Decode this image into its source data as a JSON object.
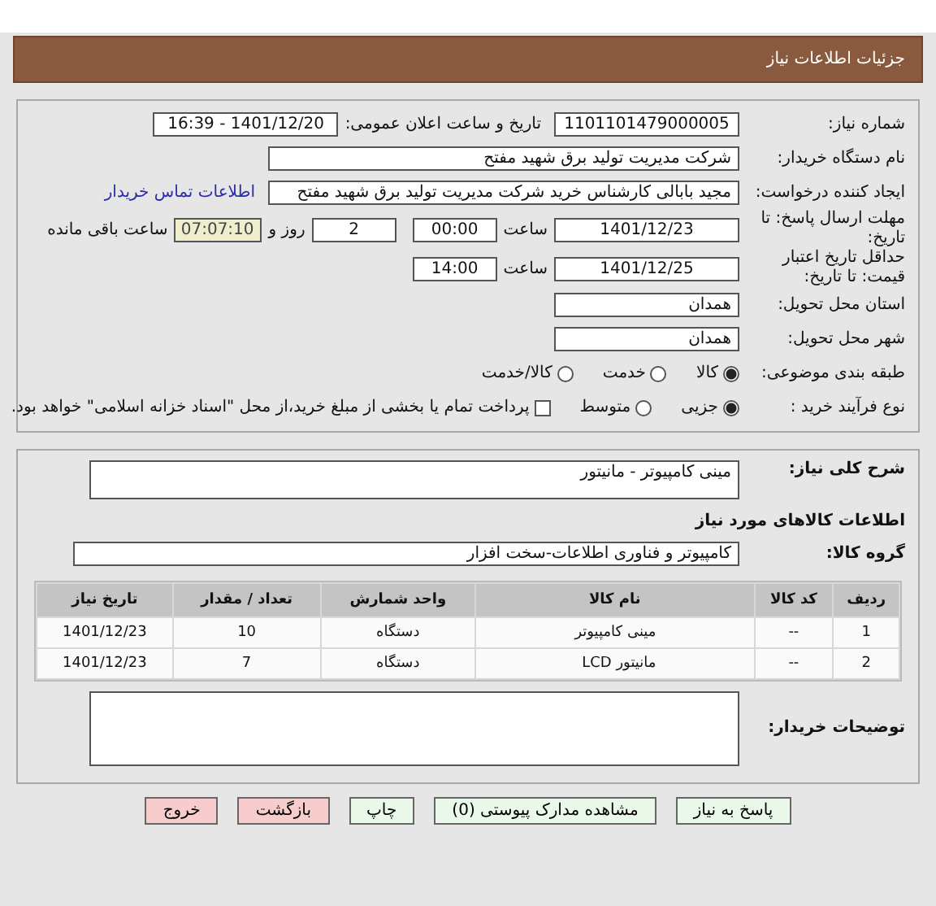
{
  "header": {
    "title": "جزئیات اطلاعات نیاز"
  },
  "need_number": {
    "label": "شماره نیاز:",
    "value": "1101101479000005"
  },
  "announce": {
    "label": "تاریخ و ساعت اعلان عمومی:",
    "value": "1401/12/20 - 16:39"
  },
  "buyer": {
    "label": "نام دستگاه خریدار:",
    "value": "شرکت مدیریت تولید برق شهید مفتح"
  },
  "creator": {
    "label": "ایجاد کننده درخواست:",
    "value": "مجید بابالی کارشناس خرید شرکت مدیریت تولید برق شهید مفتح",
    "link": "اطلاعات تماس خریدار"
  },
  "deadline": {
    "label": "مهلت ارسال پاسخ: تا تاریخ:",
    "date": "1401/12/23",
    "time_label": "ساعت",
    "time": "00:00",
    "days": "2",
    "days_label": "روز و",
    "remaining": "07:07:10",
    "remaining_label": "ساعت باقی مانده"
  },
  "validity": {
    "label": "حداقل تاریخ اعتبار قیمت: تا تاریخ:",
    "date": "1401/12/25",
    "time_label": "ساعت",
    "time": "14:00"
  },
  "province": {
    "label": "استان محل تحویل:",
    "value": "همدان"
  },
  "city": {
    "label": "شهر محل تحویل:",
    "value": "همدان"
  },
  "category": {
    "label": "طبقه بندی موضوعی:",
    "options": [
      {
        "label": "کالا",
        "selected": true
      },
      {
        "label": "خدمت",
        "selected": false
      },
      {
        "label": "کالا/خدمت",
        "selected": false
      }
    ]
  },
  "process": {
    "label": "نوع فرآیند خرید :",
    "options": [
      {
        "label": "جزیی",
        "selected": true
      },
      {
        "label": "متوسط",
        "selected": false
      }
    ],
    "payment": {
      "label": "پرداخت تمام یا بخشی از مبلغ خرید،از محل \"اسناد خزانه اسلامی\" خواهد بود.",
      "checked": false
    }
  },
  "summary": {
    "label": "شرح کلی نیاز:",
    "value": "مینی کامپیوتر - مانیتور"
  },
  "goods_heading": "اطلاعات کالاهای مورد نیاز",
  "group": {
    "label": "گروه کالا:",
    "value": "کامپیوتر و فناوری اطلاعات-سخت افزار"
  },
  "table": {
    "columns": [
      "ردیف",
      "کد کالا",
      "نام کالا",
      "واحد شمارش",
      "تعداد / مقدار",
      "تاریخ نیاز"
    ],
    "rows": [
      [
        "1",
        "--",
        "مینی کامپیوتر",
        "دستگاه",
        "10",
        "1401/12/23"
      ],
      [
        "2",
        "--",
        "مانیتور LCD",
        "دستگاه",
        "7",
        "1401/12/23"
      ]
    ]
  },
  "notes": {
    "label": "توضیحات خریدار:"
  },
  "buttons": [
    {
      "label": "پاسخ به نیاز",
      "kind": "action"
    },
    {
      "label": "مشاهده مدارک پیوستی (0)",
      "kind": "action"
    },
    {
      "label": "چاپ",
      "kind": "action"
    },
    {
      "label": "بازگشت",
      "kind": "danger"
    },
    {
      "label": "خروج",
      "kind": "danger"
    }
  ]
}
